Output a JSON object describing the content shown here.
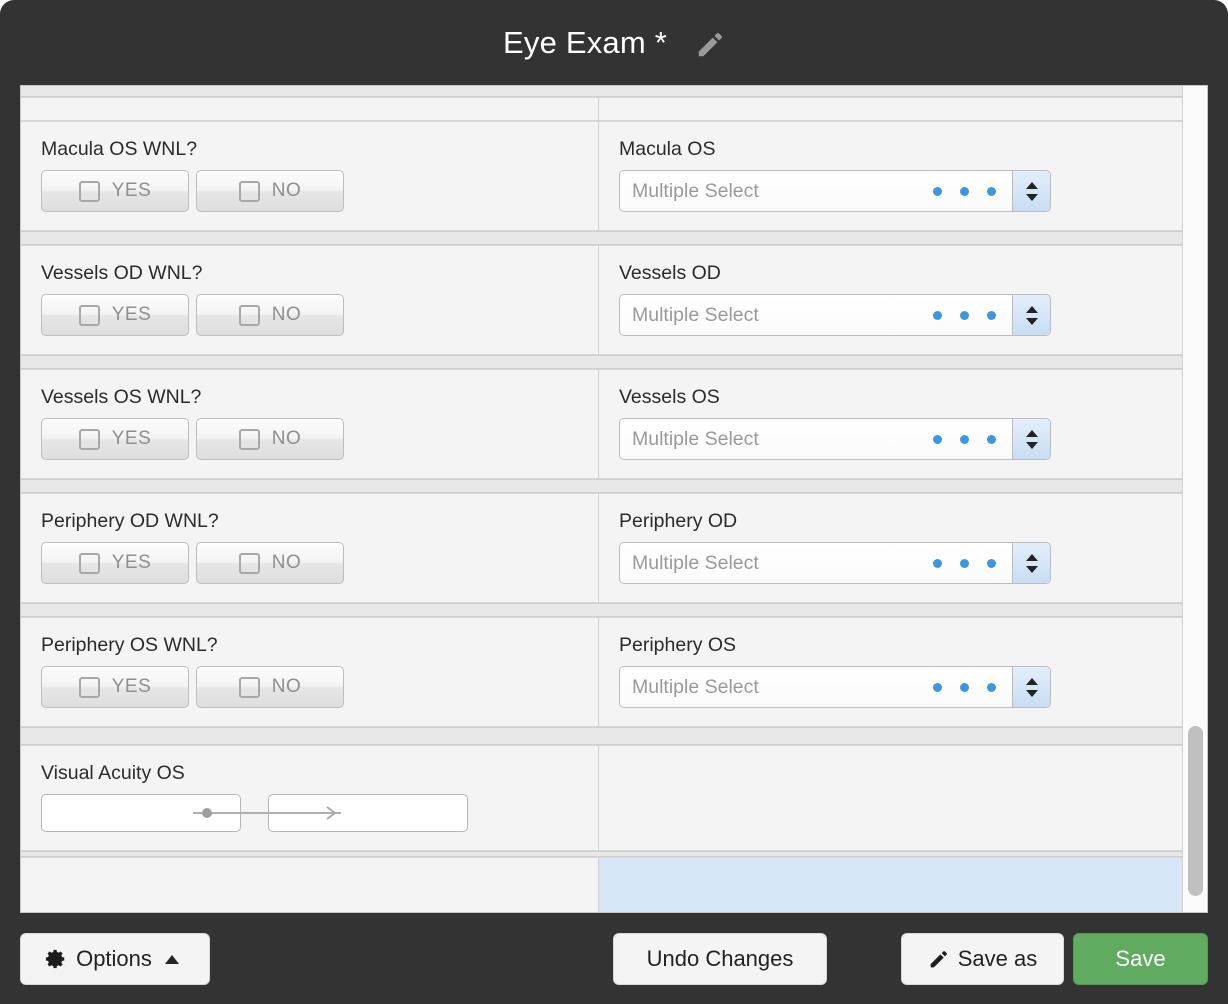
{
  "window": {
    "title": "Eye Exam *",
    "edit_icon": "pencil-icon"
  },
  "colors": {
    "chrome": "#333333",
    "panel": "#f4f4f4",
    "accent_dot": "#3b97e3",
    "selected_cell": "#d7e7f8",
    "save_green": "#61ab61",
    "delete_x": "#c08080"
  },
  "form": {
    "multi_select_placeholder": "Multiple Select",
    "yes_label": "YES",
    "no_label": "NO",
    "rows": [
      {
        "left_label": "Macula OS WNL?",
        "right_label": "Macula OS"
      },
      {
        "left_label": "Vessels OD WNL?",
        "right_label": "Vessels OD"
      },
      {
        "left_label": "Vessels OS WNL?",
        "right_label": "Vessels OS"
      },
      {
        "left_label": "Periphery OD WNL?",
        "right_label": "Periphery OD"
      },
      {
        "left_label": "Periphery OS WNL?",
        "right_label": "Periphery OS"
      }
    ],
    "visual_acuity": {
      "label": "Visual Acuity OS",
      "input_1_value": "",
      "input_2_value": ""
    },
    "last_row": {
      "delete_label": "✖"
    }
  },
  "footer": {
    "options_label": "Options",
    "undo_label": "Undo Changes",
    "save_as_label": "Save as",
    "save_label": "Save"
  }
}
